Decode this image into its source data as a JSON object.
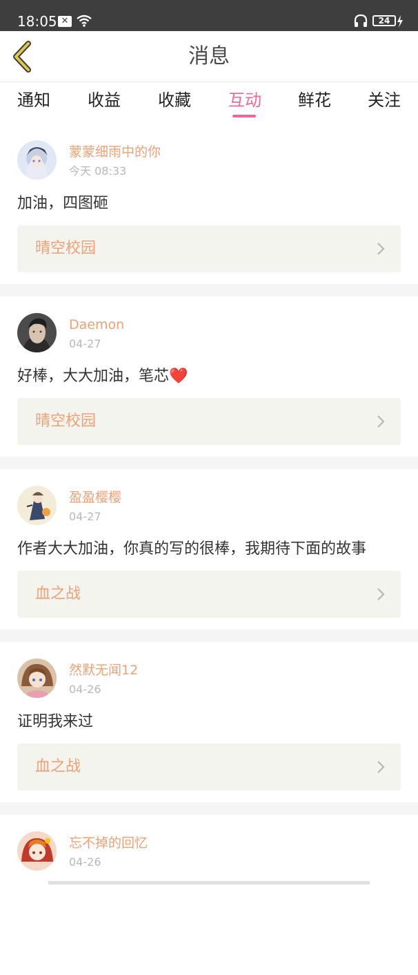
{
  "status_bar": {
    "time": "18:05",
    "notification_icon": "close-box-icon",
    "notification_glyph": "✕",
    "battery": "24",
    "icons": [
      "wifi-icon",
      "headphones-icon",
      "battery-icon",
      "charging-bolt-icon"
    ]
  },
  "header": {
    "title": "消息",
    "back_icon": "back-chevron-icon",
    "back_color": "#e0c84a"
  },
  "tabs": {
    "items": [
      "通知",
      "收益",
      "收藏",
      "互动",
      "鲜花",
      "关注"
    ],
    "active": "互动",
    "active_color": "#f0679b"
  },
  "messages": [
    {
      "user": "蒙蒙细雨中的你",
      "time": "今天 08:33",
      "content": "加油，四图砸",
      "book": "晴空校园"
    },
    {
      "user": "Daemon",
      "time": "04-27",
      "content": "好棒，大大加油，笔芯❤️",
      "book": "晴空校园"
    },
    {
      "user": "盈盈樱樱",
      "time": "04-27",
      "content": "作者大大加油，你真的写的很棒，我期待下面的故事",
      "book": "血之战"
    },
    {
      "user": "然默无闻12",
      "time": "04-26",
      "content": "证明我来过",
      "book": "血之战"
    },
    {
      "user": "忘不掉的回忆",
      "time": "04-26",
      "content": "",
      "book": ""
    }
  ],
  "colors": {
    "username": "#f0a074",
    "book_title": "#f0a074",
    "book_bg": "#f4f4ee"
  }
}
